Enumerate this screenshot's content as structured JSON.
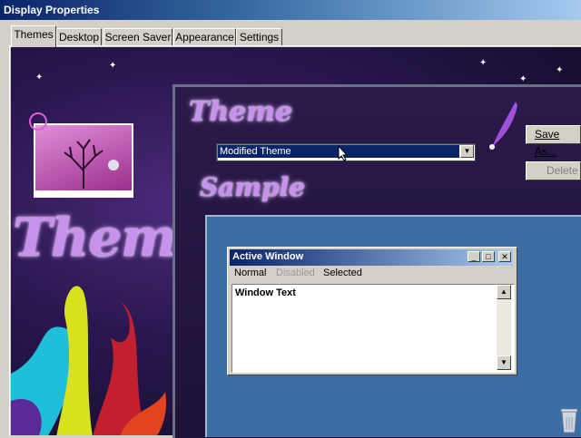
{
  "window": {
    "title": "Display Properties"
  },
  "tabs": [
    {
      "label": "Themes",
      "active": true
    },
    {
      "label": "Desktop"
    },
    {
      "label": "Screen Saver"
    },
    {
      "label": "Appearance"
    },
    {
      "label": "Settings"
    }
  ],
  "theme": {
    "heading": "Theme",
    "selected": "Modified Theme",
    "save_as_label": "Save As...",
    "delete_label": "Delete"
  },
  "sample": {
    "heading": "Sample",
    "window_title": "Active Window",
    "menu": {
      "normal": "Normal",
      "disabled": "Disabled",
      "selected": "Selected"
    },
    "window_text": "Window Text"
  },
  "artwork": {
    "title_text": "Themes"
  },
  "colors": {
    "title_bar": "#0a246a",
    "selection": "#0a246a",
    "sample_desktop": "#3a6ea5",
    "art_purple": "#c792ec"
  },
  "icons": [
    "minimize-icon",
    "maximize-icon",
    "close-icon",
    "scroll-up-icon",
    "scroll-down-icon",
    "recycle-bin-icon",
    "dropdown-arrow-icon"
  ]
}
